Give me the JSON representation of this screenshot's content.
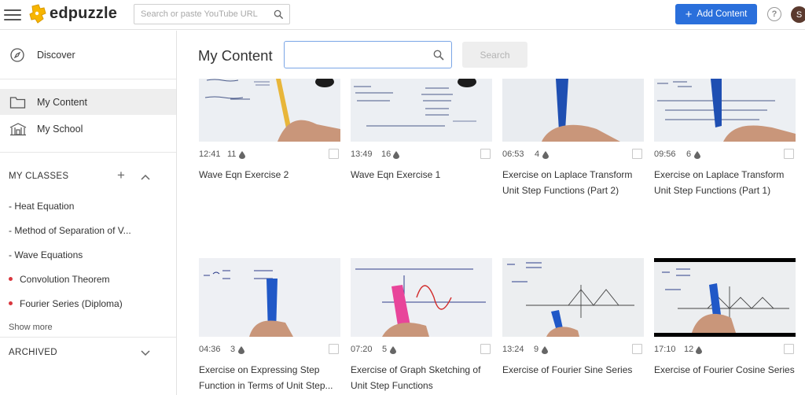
{
  "app": {
    "logo_text": "edpuzzle",
    "brand_color": "#f7b500",
    "accent_color": "#2a6fdb",
    "search_placeholder": "Search or paste YouTube URL",
    "add_content_label": "Add Content",
    "help_label": "?",
    "avatar_initial": "S"
  },
  "sidebar": {
    "nav": [
      {
        "label": "Discover",
        "icon": "compass-icon"
      },
      {
        "label": "My Content",
        "icon": "folder-icon",
        "active": true
      },
      {
        "label": "My School",
        "icon": "school-icon"
      }
    ],
    "classes_heading": "MY CLASSES",
    "classes": [
      {
        "label": "- Heat Equation",
        "dot": false
      },
      {
        "label": "- Method of Separation of V...",
        "dot": false
      },
      {
        "label": "- Wave Equations",
        "dot": false
      },
      {
        "label": "Convolution Theorem",
        "dot": true
      },
      {
        "label": "Fourier Series (Diploma)",
        "dot": true
      }
    ],
    "show_more": "Show more",
    "archived_heading": "ARCHIVED"
  },
  "main": {
    "title": "My Content",
    "search_value": "",
    "search_button": "Search",
    "cards": [
      {
        "duration": "12:41",
        "questions": "11",
        "title_lines": [
          "Wave Eqn Exercise 2"
        ]
      },
      {
        "duration": "13:49",
        "questions": "16",
        "title_lines": [
          "Wave Eqn Exercise 1"
        ]
      },
      {
        "duration": "06:53",
        "questions": "4",
        "title_lines": [
          "Exercise on Laplace Transform",
          "Unit Step Functions (Part 2)"
        ]
      },
      {
        "duration": "09:56",
        "questions": "6",
        "title_lines": [
          "Exercise on Laplace Transform",
          "Unit Step Functions (Part 1)"
        ]
      },
      {
        "duration": "04:36",
        "questions": "3",
        "title_lines": [
          "Exercise on Expressing Step",
          "Function in Terms of Unit Step..."
        ]
      },
      {
        "duration": "07:20",
        "questions": "5",
        "title_lines": [
          "Exercise of Graph Sketching of",
          "Unit Step Functions"
        ]
      },
      {
        "duration": "13:24",
        "questions": "9",
        "title_lines": [
          "Exercise of Fourier Sine Series"
        ]
      },
      {
        "duration": "17:10",
        "questions": "12",
        "title_lines": [
          "Exercise of Fourier Cosine Series"
        ]
      }
    ]
  }
}
